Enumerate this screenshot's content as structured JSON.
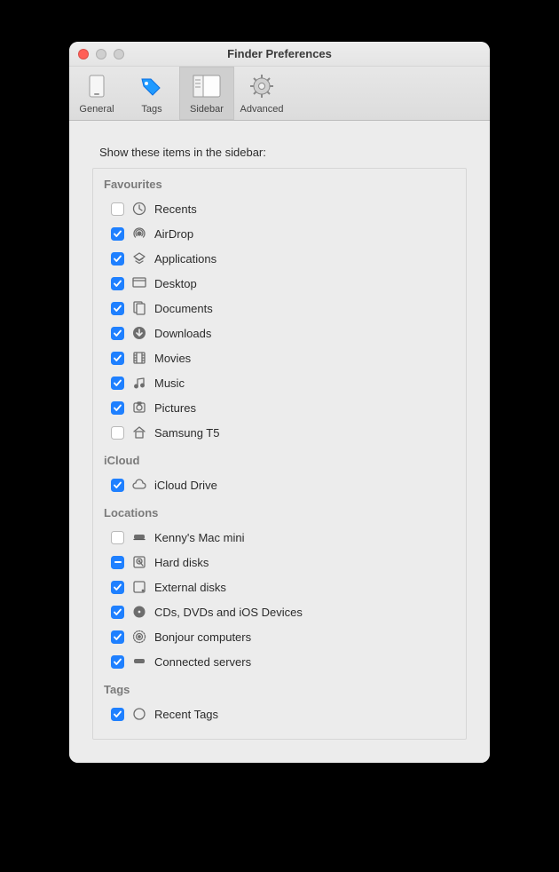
{
  "window": {
    "title": "Finder Preferences"
  },
  "toolbar": {
    "items": [
      {
        "label": "General",
        "selected": false
      },
      {
        "label": "Tags",
        "selected": false
      },
      {
        "label": "Sidebar",
        "selected": true
      },
      {
        "label": "Advanced",
        "selected": false
      }
    ]
  },
  "heading": "Show these items in the sidebar:",
  "sections": {
    "favourites": {
      "title": "Favourites",
      "items": [
        {
          "label": "Recents",
          "checked": false,
          "icon": "clock"
        },
        {
          "label": "AirDrop",
          "checked": true,
          "icon": "airdrop"
        },
        {
          "label": "Applications",
          "checked": true,
          "icon": "apps"
        },
        {
          "label": "Desktop",
          "checked": true,
          "icon": "desktop"
        },
        {
          "label": "Documents",
          "checked": true,
          "icon": "documents"
        },
        {
          "label": "Downloads",
          "checked": true,
          "icon": "downloads"
        },
        {
          "label": "Movies",
          "checked": true,
          "icon": "movies"
        },
        {
          "label": "Music",
          "checked": true,
          "icon": "music"
        },
        {
          "label": "Pictures",
          "checked": true,
          "icon": "pictures"
        },
        {
          "label": "Samsung T5",
          "checked": false,
          "icon": "home"
        }
      ]
    },
    "icloud": {
      "title": "iCloud",
      "items": [
        {
          "label": "iCloud Drive",
          "checked": true,
          "icon": "cloud"
        }
      ]
    },
    "locations": {
      "title": "Locations",
      "items": [
        {
          "label": "Kenny's Mac mini",
          "checked": false,
          "icon": "macmini"
        },
        {
          "label": "Hard disks",
          "checked": "mixed",
          "icon": "harddisk"
        },
        {
          "label": "External disks",
          "checked": true,
          "icon": "external"
        },
        {
          "label": "CDs, DVDs and iOS Devices",
          "checked": true,
          "icon": "disc"
        },
        {
          "label": "Bonjour computers",
          "checked": true,
          "icon": "bonjour"
        },
        {
          "label": "Connected servers",
          "checked": true,
          "icon": "server"
        }
      ]
    },
    "tags": {
      "title": "Tags",
      "items": [
        {
          "label": "Recent Tags",
          "checked": true,
          "icon": "tagcircle"
        }
      ]
    }
  }
}
